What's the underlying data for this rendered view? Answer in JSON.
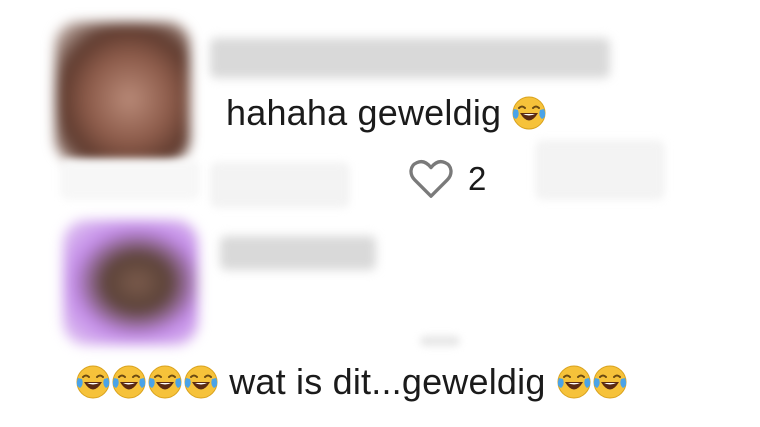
{
  "comments": [
    {
      "text": "hahaha geweldig",
      "trailing_emoji": "face-with-tears-of-joy",
      "likes": "2"
    },
    {
      "leading_emojis": [
        "face-with-tears-of-joy",
        "face-with-tears-of-joy",
        "face-with-tears-of-joy",
        "face-with-tears-of-joy"
      ],
      "text": "wat is dit...geweldig",
      "trailing_emojis": [
        "face-with-tears-of-joy",
        "face-with-tears-of-joy"
      ]
    }
  ],
  "icons": {
    "like": "heart-outline-icon"
  },
  "colors": {
    "text": "#1b1b1b",
    "heart_stroke": "#7a7a7a",
    "emoji_face": "#f6c23a",
    "emoji_tear": "#4aa3e8"
  }
}
